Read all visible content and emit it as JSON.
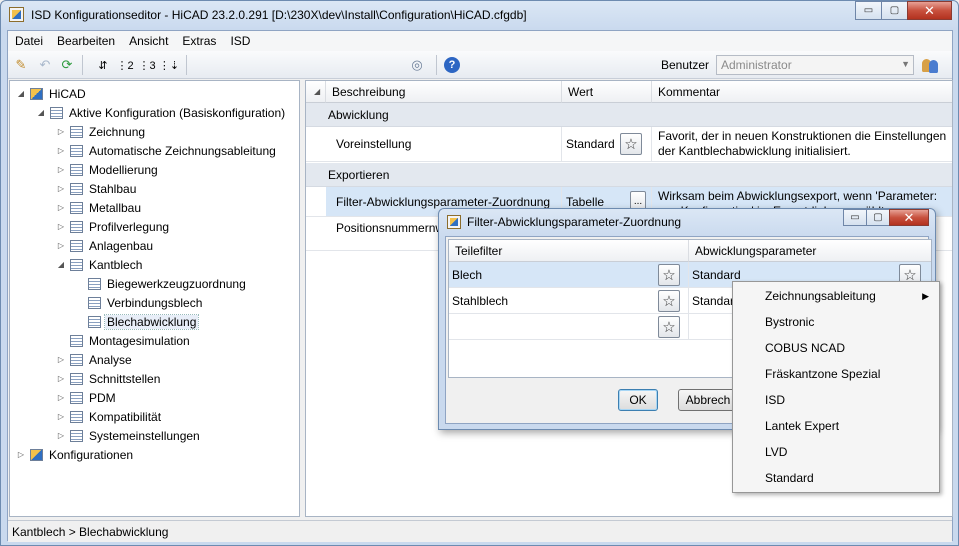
{
  "window": {
    "title": "ISD Konfigurationseditor  -  HiCAD 23.2.0.291 [D:\\230X\\dev\\Install\\Configuration\\HiCAD.cfgdb]",
    "min": "▭",
    "max": "▢",
    "close": "✕"
  },
  "menu": [
    "Datei",
    "Bearbeiten",
    "Ansicht",
    "Extras",
    "ISD"
  ],
  "toolbar": {
    "user_label": "Benutzer",
    "user_value": "Administrator"
  },
  "tree": [
    {
      "label": "HiCAD",
      "level": 0,
      "twisty": "◢"
    },
    {
      "label": "Aktive Konfiguration (Basiskonfiguration)",
      "level": 1,
      "twisty": "◢"
    },
    {
      "label": "Zeichnung",
      "level": 2,
      "twisty": "▷"
    },
    {
      "label": "Automatische Zeichnungsableitung",
      "level": 2,
      "twisty": "▷"
    },
    {
      "label": "Modellierung",
      "level": 2,
      "twisty": "▷"
    },
    {
      "label": "Stahlbau",
      "level": 2,
      "twisty": "▷"
    },
    {
      "label": "Metallbau",
      "level": 2,
      "twisty": "▷"
    },
    {
      "label": "Profilverlegung",
      "level": 2,
      "twisty": "▷"
    },
    {
      "label": "Anlagenbau",
      "level": 2,
      "twisty": "▷"
    },
    {
      "label": "Kantblech",
      "level": 2,
      "twisty": "◢"
    },
    {
      "label": "Biegewerkzeugzuordnung",
      "level": 3,
      "twisty": ""
    },
    {
      "label": "Verbindungsblech",
      "level": 3,
      "twisty": ""
    },
    {
      "label": "Blechabwicklung",
      "level": 3,
      "twisty": "",
      "selected": true
    },
    {
      "label": "Montagesimulation",
      "level": 2,
      "twisty": ""
    },
    {
      "label": "Analyse",
      "level": 2,
      "twisty": "▷"
    },
    {
      "label": "Schnittstellen",
      "level": 2,
      "twisty": "▷"
    },
    {
      "label": "PDM",
      "level": 2,
      "twisty": "▷"
    },
    {
      "label": "Kompatibilität",
      "level": 2,
      "twisty": "▷"
    },
    {
      "label": "Systemeinstellungen",
      "level": 2,
      "twisty": "▷"
    },
    {
      "label": "Konfigurationen",
      "level": 0,
      "twisty": "▷"
    }
  ],
  "grid": {
    "columns": [
      "Beschreibung",
      "Wert",
      "Kommentar"
    ],
    "groups": [
      "Abwicklung",
      "Exportieren"
    ],
    "rows": [
      {
        "desc": "Voreinstellung",
        "value": "Standard",
        "comment": "Favorit, der in neuen Konstruktionen die Einstellungen der Kantblechabwicklung initialisiert."
      },
      {
        "desc": "Filter-Abwicklungsparameter-Zuordnung",
        "value": "Tabelle",
        "comment": "Wirksam beim Abwicklungsexport, wenn 'Parameter: aus Konfiguration' im Exportdialog gewählt"
      },
      {
        "desc": "Positionsnummernw zusammenfassen",
        "value": "",
        "comment": ""
      }
    ],
    "dots_label": "..."
  },
  "status": "Kantblech > Blechabwicklung",
  "dialog": {
    "title": "Filter-Abwicklungsparameter-Zuordnung",
    "columns": [
      "Teilefilter",
      "Abwicklungsparameter"
    ],
    "rows": [
      {
        "filter": "Blech",
        "param": "Standard"
      },
      {
        "filter": "Stahlblech",
        "param": "Standar"
      },
      {
        "filter": "",
        "param": ""
      }
    ],
    "ok": "OK",
    "cancel": "Abbrech"
  },
  "popup": {
    "items": [
      "Zeichnungsableitung",
      "Bystronic",
      "COBUS NCAD",
      "Fräskantzone Spezial",
      "ISD",
      "Lantek Expert",
      "LVD",
      "Standard"
    ],
    "submenu_arrow": "▶"
  }
}
